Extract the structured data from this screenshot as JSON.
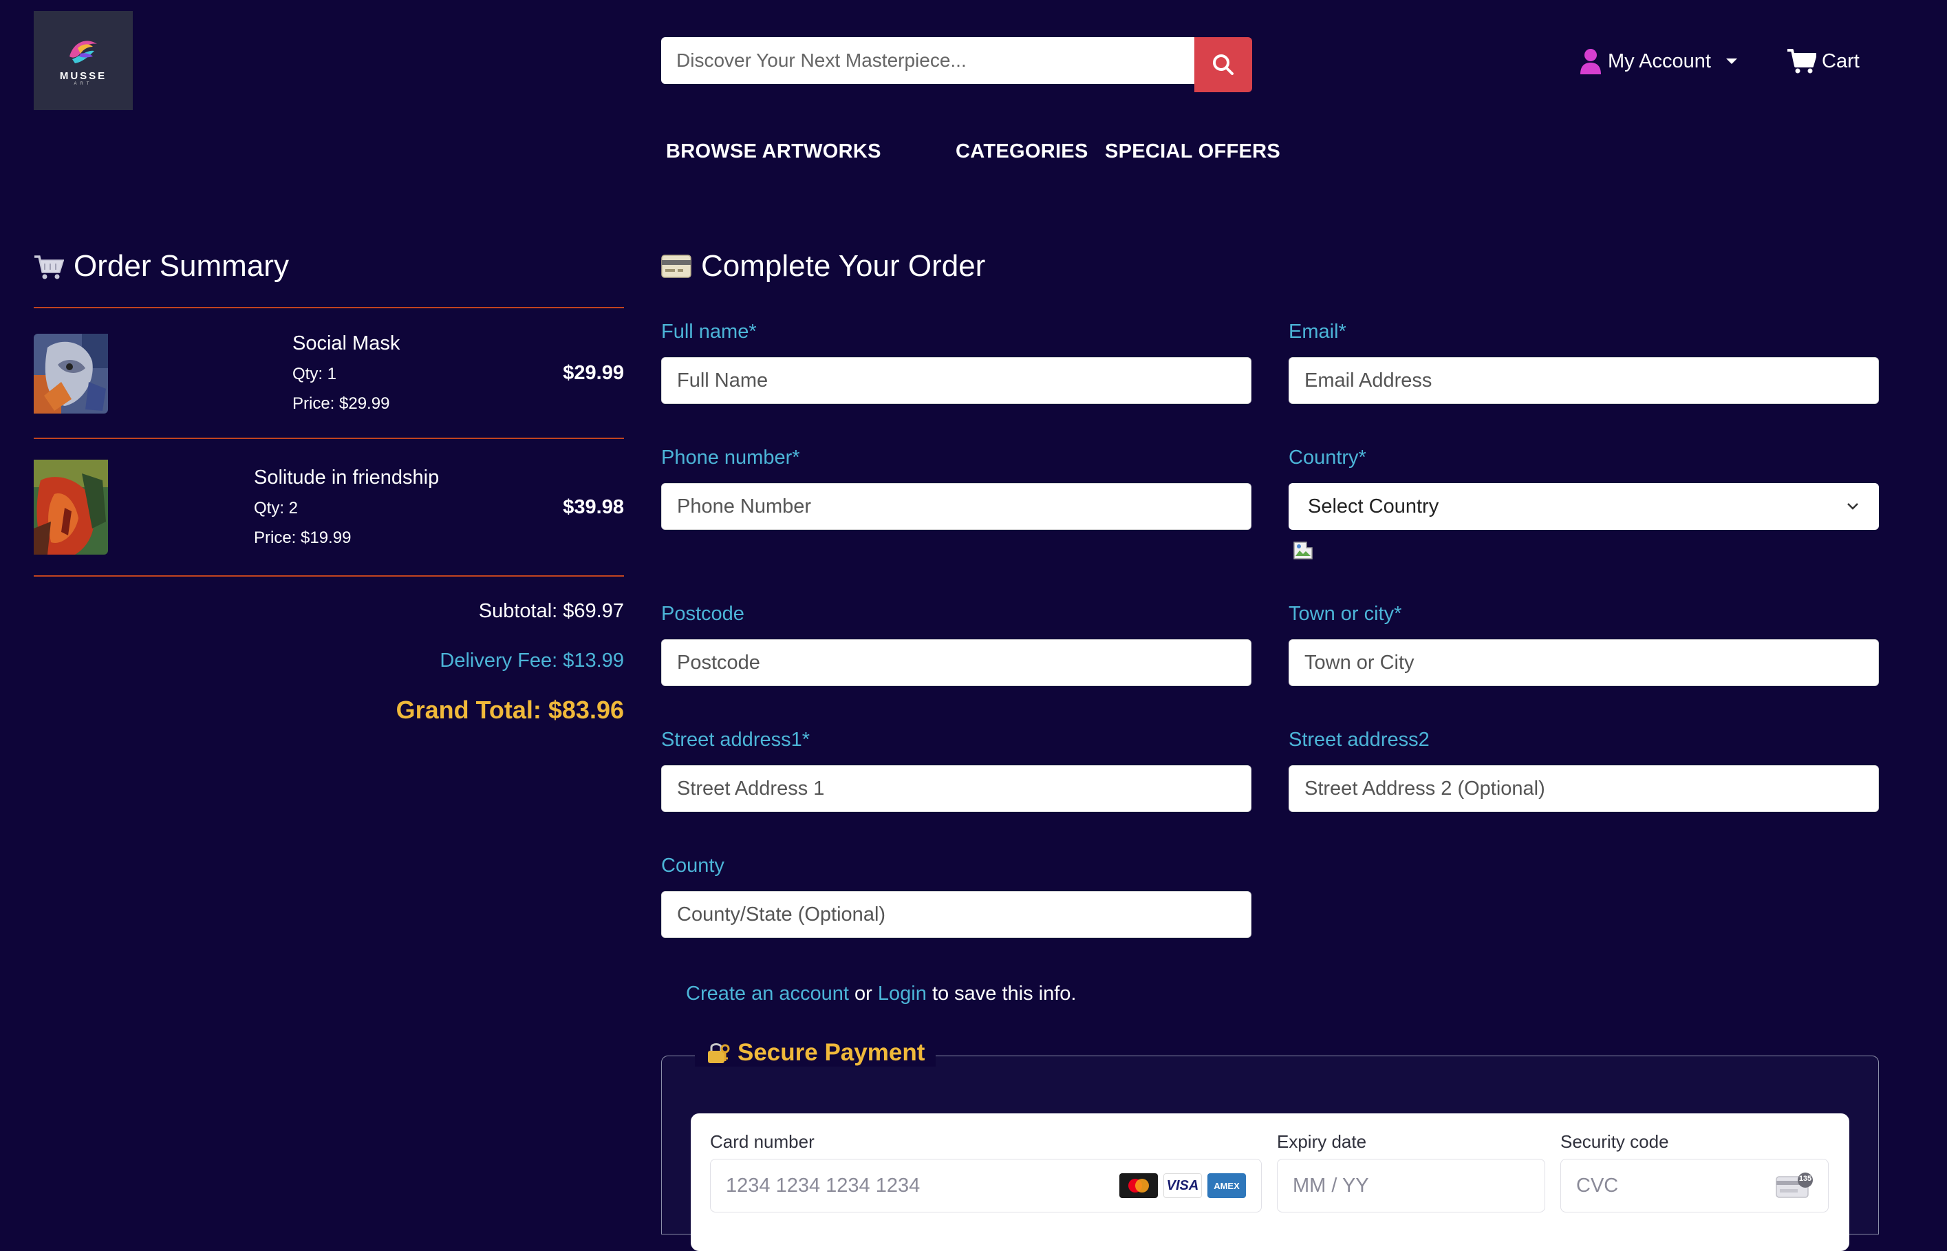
{
  "header": {
    "logo": {
      "name": "MUSSE",
      "sub": "ART"
    },
    "search": {
      "placeholder": "Discover Your Next Masterpiece..."
    },
    "account_label": "My Account",
    "cart_label": "Cart"
  },
  "nav": {
    "browse": "BROWSE ARTWORKS",
    "categories": "CATEGORIES",
    "offers": "SPECIAL OFFERS"
  },
  "summary": {
    "title": "Order Summary",
    "items": [
      {
        "name": "Social Mask",
        "qty": "Qty: 1",
        "price": "Price: $29.99",
        "total": "$29.99"
      },
      {
        "name": "Solitude in friendship",
        "qty": "Qty: 2",
        "price": "Price: $19.99",
        "total": "$39.98"
      }
    ],
    "subtotal": "Subtotal: $69.97",
    "delivery": "Delivery Fee: $13.99",
    "grand_total": "Grand Total: $83.96"
  },
  "form": {
    "title": "Complete Your Order",
    "full_name": {
      "label": "Full name*",
      "placeholder": "Full Name"
    },
    "email": {
      "label": "Email*",
      "placeholder": "Email Address"
    },
    "phone": {
      "label": "Phone number*",
      "placeholder": "Phone Number"
    },
    "country": {
      "label": "Country*",
      "value": "Select Country"
    },
    "postcode": {
      "label": "Postcode",
      "placeholder": "Postcode"
    },
    "town": {
      "label": "Town or city*",
      "placeholder": "Town or City"
    },
    "street1": {
      "label": "Street address1*",
      "placeholder": "Street Address 1"
    },
    "street2": {
      "label": "Street address2",
      "placeholder": "Street Address 2 (Optional)"
    },
    "county": {
      "label": "County",
      "placeholder": "County/State (Optional)"
    },
    "save": {
      "create_link": "Create an account",
      "or": "or",
      "login_link": "Login",
      "suffix": "to save this info."
    }
  },
  "payment": {
    "title": "Secure Payment",
    "card_number": {
      "label": "Card number",
      "placeholder": "1234 1234 1234 1234"
    },
    "expiry": {
      "label": "Expiry date",
      "placeholder": "MM / YY"
    },
    "security": {
      "label": "Security code",
      "placeholder": "CVC"
    },
    "brands": {
      "visa": "VISA",
      "amex": "AMEX",
      "cvc_badge": "135"
    }
  },
  "colors": {
    "background": "#0e0539",
    "accent_blue": "#4cb5d8",
    "accent_gold": "#f0b93a",
    "search_button": "#d9424b",
    "divider": "#c1441f",
    "account_icon": "#d63fd0"
  }
}
